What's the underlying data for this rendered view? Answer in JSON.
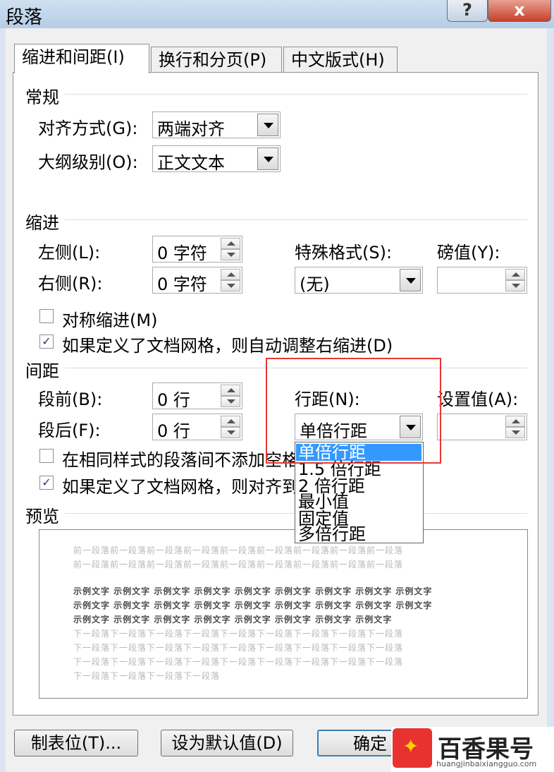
{
  "window": {
    "title": "段落",
    "help_label": "?",
    "close_label": "x"
  },
  "tabs": [
    {
      "label": "缩进和间距(I)",
      "active": true
    },
    {
      "label": "换行和分页(P)",
      "active": false
    },
    {
      "label": "中文版式(H)",
      "active": false
    }
  ],
  "general": {
    "section": "常规",
    "alignment_label": "对齐方式(G):",
    "alignment_value": "两端对齐",
    "outline_label": "大纲级别(O):",
    "outline_value": "正文文本"
  },
  "indent": {
    "section": "缩进",
    "left_label": "左侧(L):",
    "left_value": "0 字符",
    "right_label": "右侧(R):",
    "right_value": "0 字符",
    "special_label": "特殊格式(S):",
    "special_value": "(无)",
    "by_label": "磅值(Y):",
    "by_value": "",
    "mirror_label": "对称缩进(M)",
    "mirror_checked": false,
    "grid_label": "如果定义了文档网格，则自动调整右缩进(D)",
    "grid_checked": true
  },
  "spacing": {
    "section": "间距",
    "before_label": "段前(B):",
    "before_value": "0 行",
    "after_label": "段后(F):",
    "after_value": "0 行",
    "line_spacing_label": "行距(N):",
    "line_spacing_value": "单倍行距",
    "at_label": "设置值(A):",
    "at_value": "",
    "no_space_label": "在相同样式的段落间不添加空格",
    "no_space_checked": false,
    "snap_label": "如果定义了文档网格，则对齐到",
    "snap_checked": true,
    "dropdown_options": [
      "单倍行距",
      "1.5 倍行距",
      "2 倍行距",
      "最小值",
      "固定值",
      "多倍行距"
    ],
    "selected_option": "单倍行距"
  },
  "preview": {
    "section": "预览",
    "prev_line": "前一段落前一段落前一段落前一段落前一段落前一段落前一段落前一段落前一段落",
    "sample_line": "示例文字 示例文字 示例文字 示例文字 示例文字 示例文字 示例文字 示例文字 示例文字",
    "sample_short": "示例文字 示例文字 示例文字 示例文字 示例文字 示例文字 示例文字 示例文字",
    "next_line": "下一段落下一段落下一段落下一段落下一段落下一段落下一段落下一段落下一段落",
    "next_short": "下一段落下一段落下一段落下一段落"
  },
  "buttons": {
    "tabs_label": "制表位(T)...",
    "default_label": "设为默认值(D)",
    "ok_label": "确定"
  },
  "watermark": {
    "name": "百香果号",
    "url": "huangjinbaixiangguo.com"
  },
  "colors": {
    "selection": "#3399ff",
    "highlight_box": "#e53935",
    "watermark": "#e8322f"
  }
}
